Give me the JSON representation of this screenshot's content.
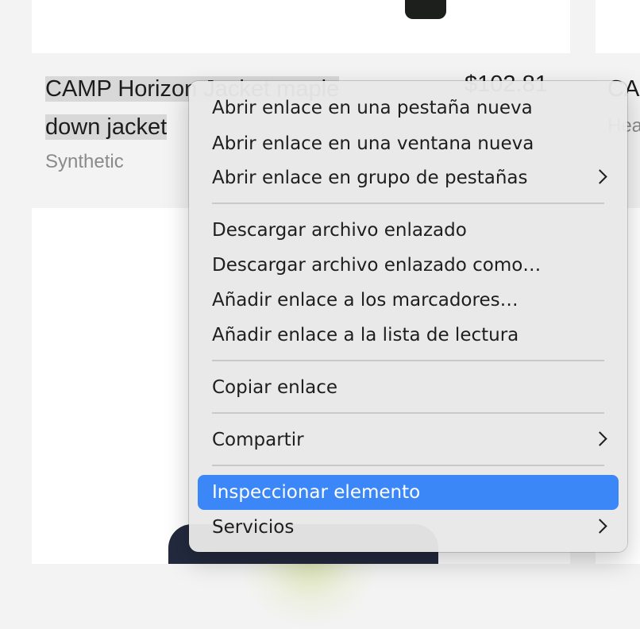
{
  "product": {
    "title": "CAMP Horizon Jacket maple down jacket",
    "price": "$102.81",
    "material": "Synthetic",
    "right_title": "CAMP c",
    "right_sub": "Hea"
  },
  "context_menu": {
    "items": [
      {
        "label": "Abrir enlace en una pestaña nueva",
        "submenu": false
      },
      {
        "label": "Abrir enlace en una ventana nueva",
        "submenu": false
      },
      {
        "label": "Abrir enlace en grupo de pestañas",
        "submenu": true
      },
      {
        "label": "Descargar archivo enlazado",
        "submenu": false
      },
      {
        "label": "Descargar archivo enlazado como…",
        "submenu": false
      },
      {
        "label": "Añadir enlace a los marcadores…",
        "submenu": false
      },
      {
        "label": "Añadir enlace a la lista de lectura",
        "submenu": false
      },
      {
        "label": "Copiar enlace",
        "submenu": false
      },
      {
        "label": "Compartir",
        "submenu": true
      },
      {
        "label": "Inspeccionar elemento",
        "submenu": false,
        "highlighted": true
      },
      {
        "label": "Servicios",
        "submenu": true
      }
    ]
  },
  "colors": {
    "highlight": "#3b87f7",
    "page_background": "#f3f3f3"
  }
}
